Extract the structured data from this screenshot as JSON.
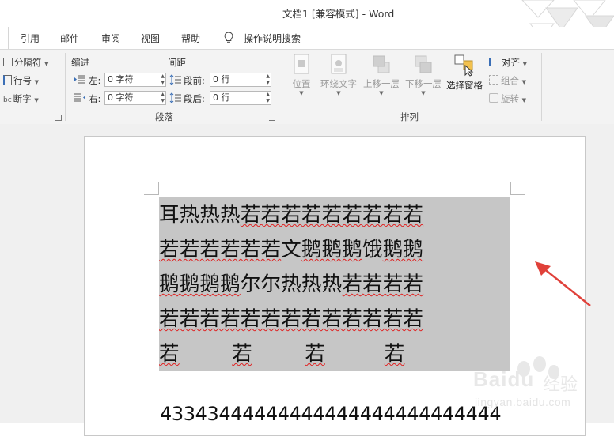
{
  "window": {
    "title": "文档1 [兼容模式]  -  Word"
  },
  "tabs": [
    {
      "label": "引用"
    },
    {
      "label": "邮件"
    },
    {
      "label": "审阅"
    },
    {
      "label": "视图"
    },
    {
      "label": "帮助"
    },
    {
      "label": "操作说明搜索",
      "icon": "lightbulb-icon"
    }
  ],
  "ribbon": {
    "page_setup_partial": {
      "breaks": "分隔符",
      "line_numbers": "行号",
      "hyphenation": "断字"
    },
    "paragraph": {
      "group_label": "段落",
      "indent_header": "缩进",
      "spacing_header": "间距",
      "indent_left_label": "左:",
      "indent_left_value": "0 字符",
      "indent_right_label": "右:",
      "indent_right_value": "0 字符",
      "space_before_label": "段前:",
      "space_before_value": "0 行",
      "space_after_label": "段后:",
      "space_after_value": "0 行"
    },
    "arrange": {
      "group_label": "排列",
      "position": "位置",
      "wrap_text": "环绕文字",
      "bring_forward": "上移一层",
      "send_backward": "下移一层",
      "selection_pane": "选择窗格",
      "align": "对齐",
      "group": "组合",
      "rotate": "旋转"
    }
  },
  "document": {
    "lines": [
      [
        {
          "t": "耳热热热",
          "u": false
        },
        {
          "t": "若若若若若若若若若",
          "u": true
        }
      ],
      [
        {
          "t": "若若若若若若",
          "u": true
        },
        {
          "t": "文",
          "u": false
        },
        {
          "t": "鹅鹅鹅",
          "u": true
        },
        {
          "t": "饿",
          "u": false
        },
        {
          "t": "鹅鹅",
          "u": true
        }
      ],
      [
        {
          "t": "鹅鹅鹅鹅",
          "u": true
        },
        {
          "t": "尔尔热热热",
          "u": false
        },
        {
          "t": "若若若若",
          "u": true
        }
      ],
      [
        {
          "t": "若若若若若若若若若若若若若",
          "u": true
        }
      ],
      [
        {
          "t": "若",
          "u": true
        },
        {
          "t": "        ",
          "u": false
        },
        {
          "t": "若",
          "u": true
        },
        {
          "t": "        ",
          "u": false
        },
        {
          "t": "若",
          "u": true
        },
        {
          "t": "         ",
          "u": false
        },
        {
          "t": "若",
          "u": true
        }
      ]
    ],
    "number_line": "43343444444444444444444444444"
  },
  "watermark": {
    "brand": "Baidu",
    "product": "经验",
    "url": "jingyan.baidu.com"
  },
  "colors": {
    "selection": "#c6c6c6",
    "spell_underline": "#e02020",
    "annotation_arrow": "#e0413a",
    "ribbon_bg": "#f3f3f3"
  }
}
